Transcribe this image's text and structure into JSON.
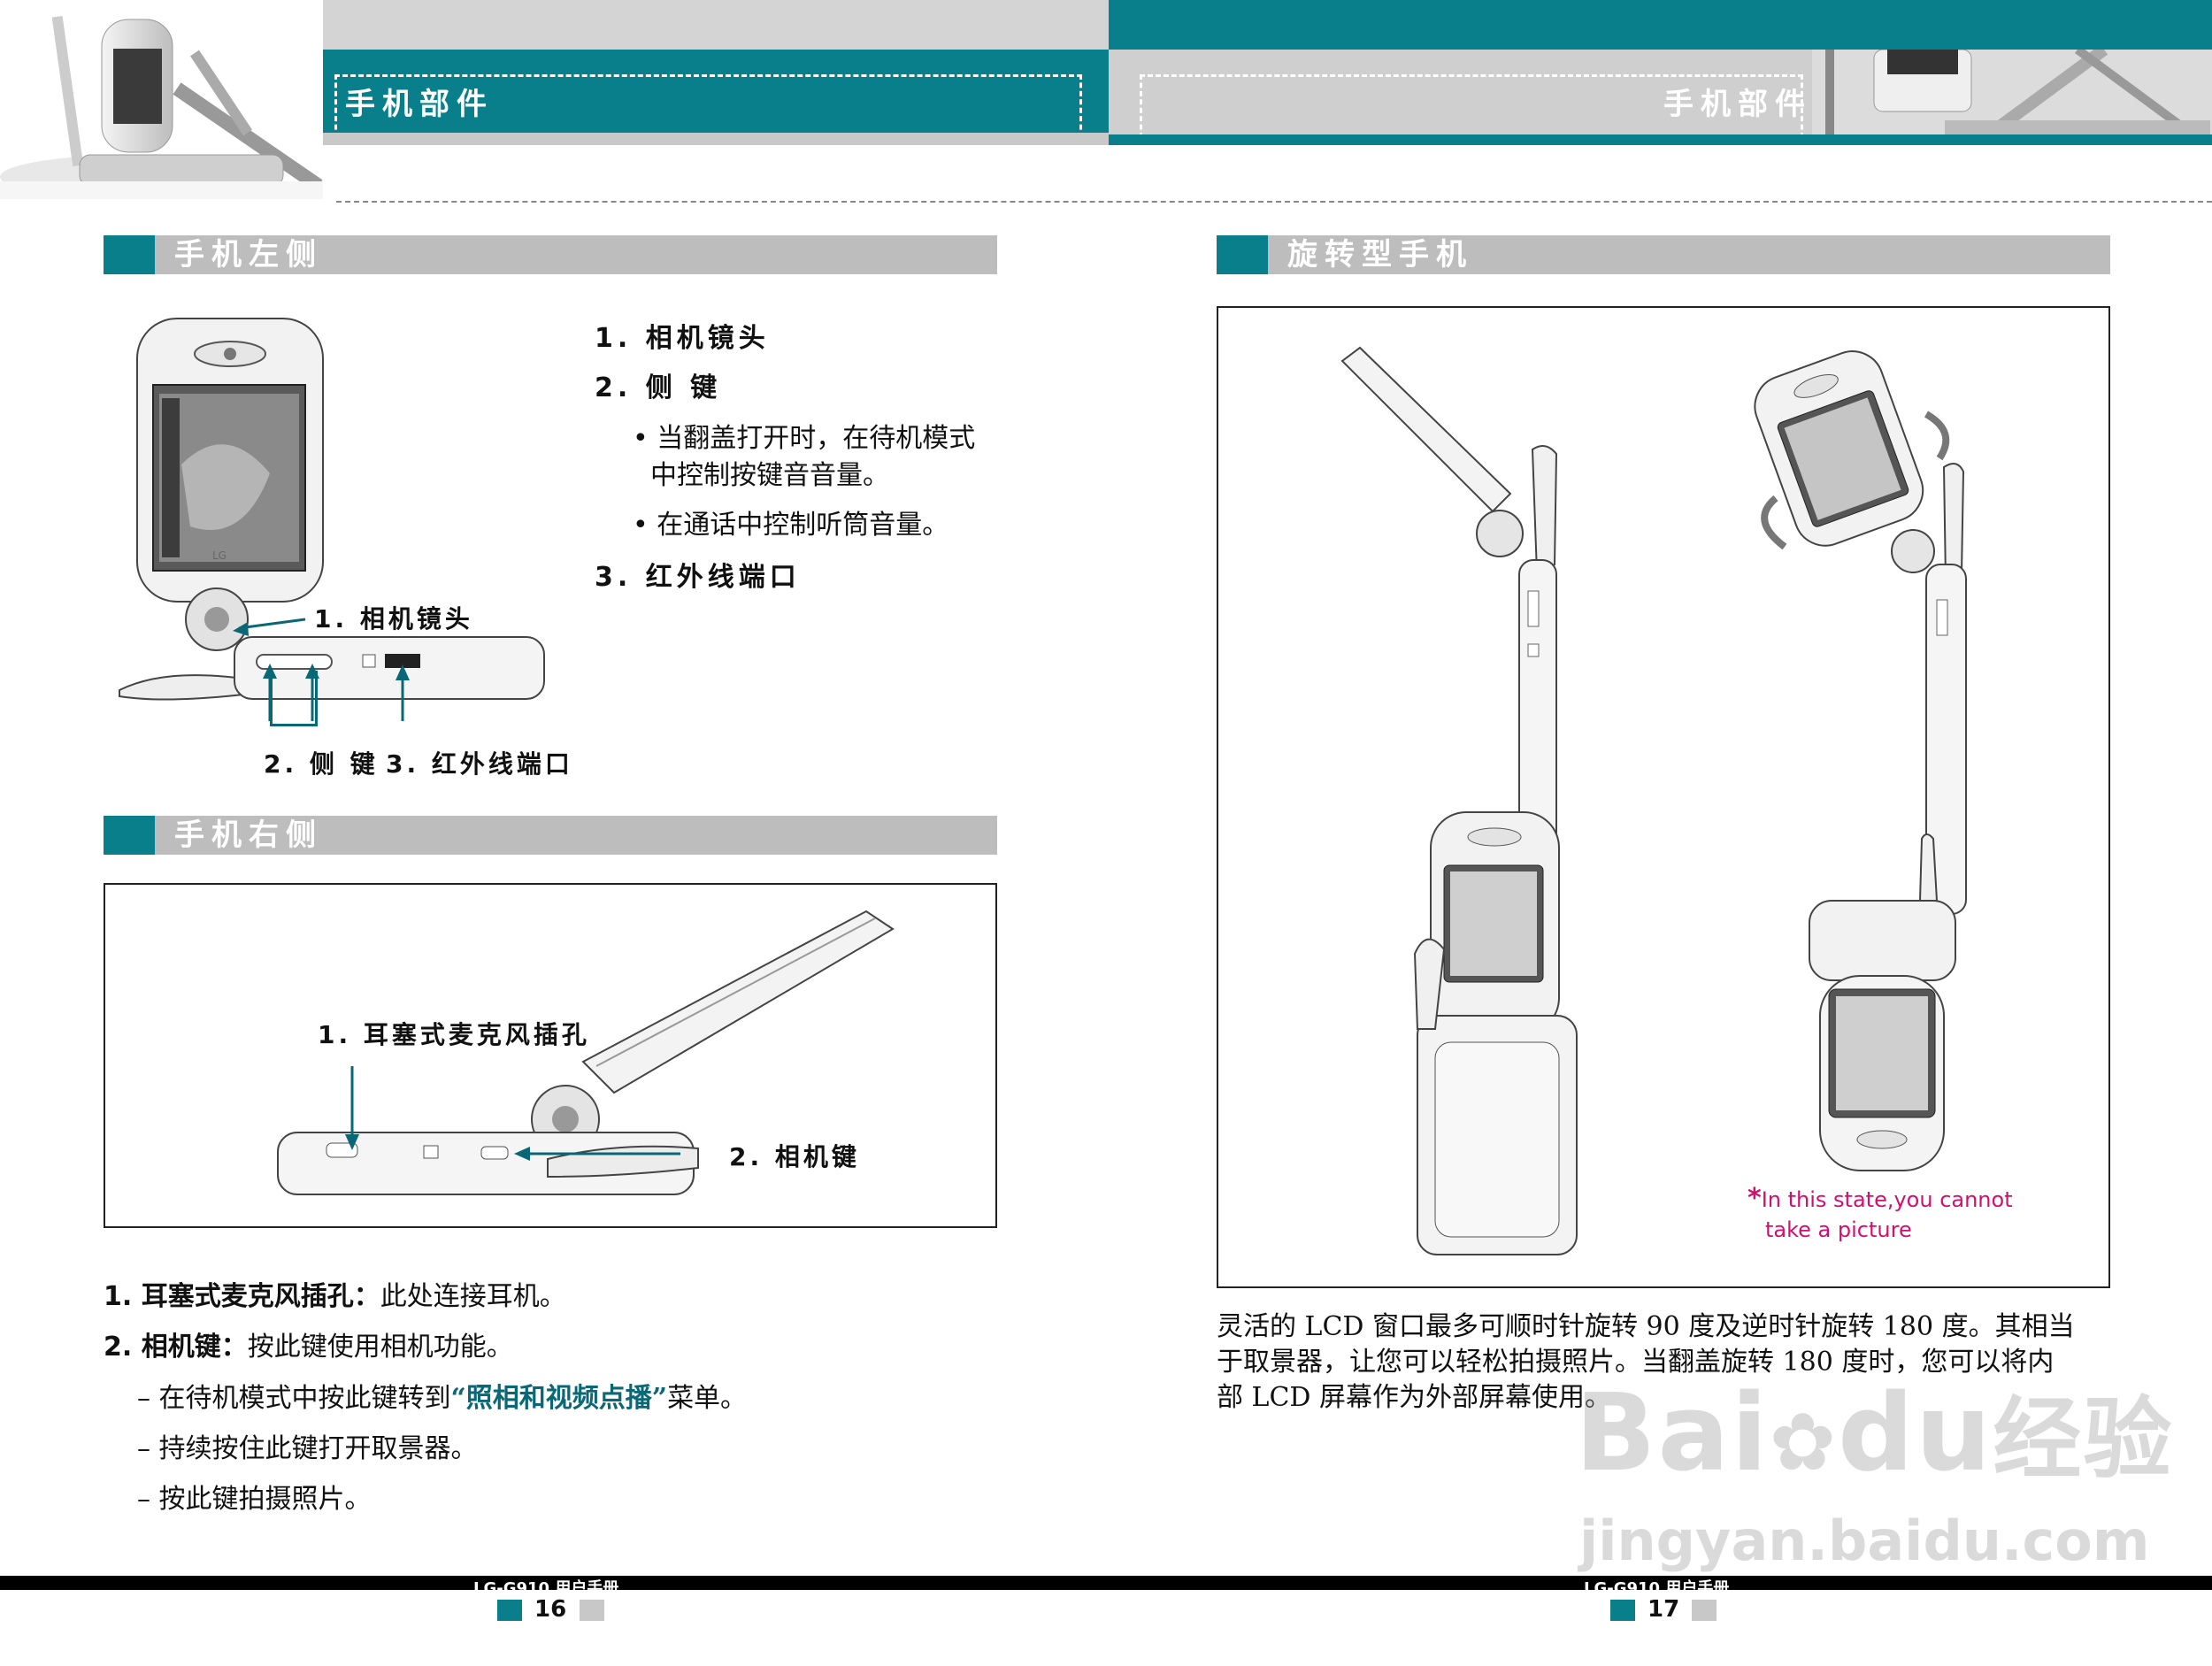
{
  "header": {
    "left_title": "手机部件",
    "right_title": "手机部件"
  },
  "left_page": {
    "section1": {
      "title": "手机左侧",
      "diagram_labels": {
        "camera_lens": "1. 相机镜头",
        "side_key": "2. 侧 键",
        "ir_port": "3. 红外线端口"
      },
      "items": [
        {
          "label": "1. 相机镜头"
        },
        {
          "label": "2. 侧 键",
          "bullets": [
            "• 当翻盖打开时，在待机模式",
            "中控制按键音音量。",
            "• 在通话中控制听筒音量。"
          ]
        },
        {
          "label": "3. 红外线端口"
        }
      ]
    },
    "section2": {
      "title": "手机右侧",
      "diagram_labels": {
        "earphone_jack": "1. 耳塞式麦克风插孔",
        "camera_key": "2. 相机键"
      },
      "descriptions": {
        "d1_label": "1. 耳塞式麦克风插孔：",
        "d1_text": "此处连接耳机。",
        "d2_label": "2. 相机键：",
        "d2_text": "按此键使用相机功能。",
        "d3_prefix": "– 在待机模式中按此键转到",
        "d3_highlight": "“照相和视频点播”",
        "d3_suffix": "菜单。",
        "d4": "– 持续按住此键打开取景器。",
        "d5": "– 按此键拍摄照片。"
      }
    },
    "footer": {
      "model": "LG-G910 用户手册",
      "page": "16"
    }
  },
  "right_page": {
    "section": {
      "title": "旋转型手机",
      "note_star": "*",
      "note_line1": "In  this  state,you  cannot",
      "note_line2": "take  a  picture",
      "paragraph_lines": [
        "灵活的 LCD 窗口最多可顺时针旋转 90 度及逆时针旋转 180 度。其相当",
        "于取景器，让您可以轻松拍摄照片。当翻盖旋转 180 度时，您可以将内",
        "部 LCD 屏幕作为外部屏幕使用。"
      ]
    },
    "footer": {
      "model": "LG-G910 用户手册",
      "page": "17"
    }
  },
  "phone_brand": "LG",
  "watermark": {
    "brand": "Bai",
    "brand2": "du",
    "cn": "经验",
    "url": "jingyan.baidu.com"
  },
  "colors": {
    "teal": "#0a7f8c",
    "gray_bar": "#bdbdbd",
    "pink": "#d0106f"
  }
}
